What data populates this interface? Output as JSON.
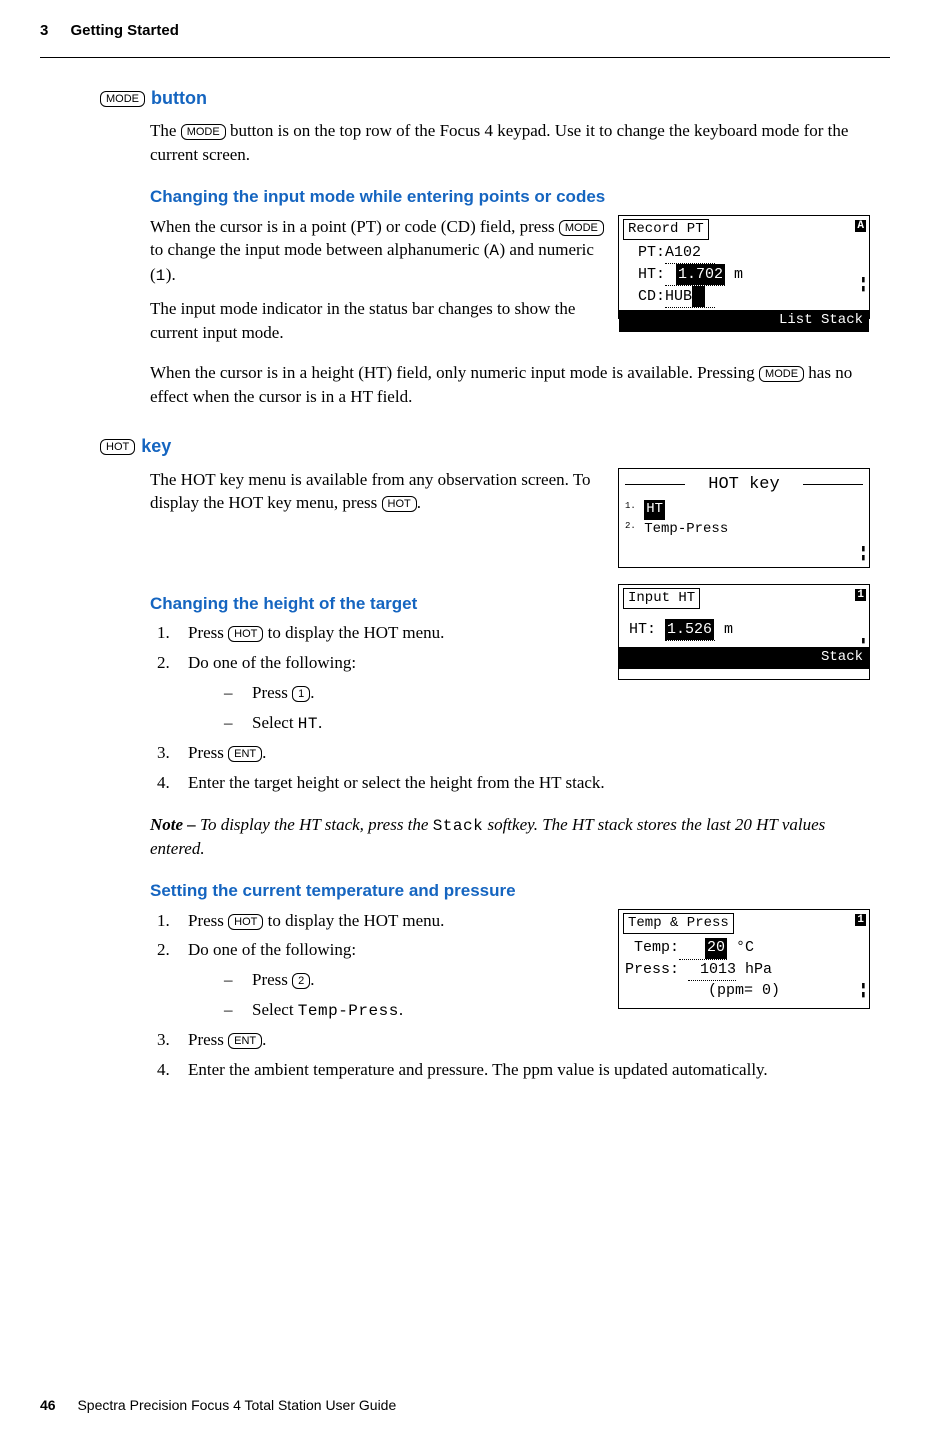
{
  "header": {
    "chapter_num": "3",
    "chapter_title": "Getting Started"
  },
  "footer": {
    "page_num": "46",
    "book_title": "Spectra Precision Focus 4 Total Station User Guide"
  },
  "keys": {
    "mode": "MODE",
    "hot": "HOT",
    "ent": "ENT",
    "one": "1",
    "two": "2"
  },
  "mono": {
    "A": "A",
    "one": "1",
    "HT": "HT",
    "TempPress": "Temp-Press",
    "Stack": "Stack"
  },
  "sec_mode": {
    "title_suffix": "button",
    "p1a": "The ",
    "p1b": " button is on the top row of the Focus 4 keypad. Use it to change the keyboard mode for the current screen."
  },
  "sec_changing_input": {
    "title": "Changing the input mode while entering points or codes",
    "p1a": "When the cursor is in a point (PT) or code (CD) field, press ",
    "p1b": " to change the input mode between alphanumeric (",
    "p1c": ") and numeric (",
    "p1d": ").",
    "p2": "The input mode indicator in the status bar changes to show the current input mode.",
    "p3a": "When the cursor is in a height (HT) field, only numeric input mode is available. Pressing ",
    "p3b": " has no effect when the cursor is in a HT field."
  },
  "sec_hot": {
    "title_suffix": "key",
    "p1a": "The HOT key menu is available from any observation screen. To display the HOT key menu, press ",
    "p1b": "."
  },
  "sec_height": {
    "title": "Changing the height of the target",
    "s1a": "Press ",
    "s1b": " to display the HOT menu.",
    "s2": "Do one of the following:",
    "s2a": "Press ",
    "s2a2": ".",
    "s2b": "Select ",
    "s2b2": ".",
    "s3a": "Press ",
    "s3b": ".",
    "s4": "Enter the target height or select the height from the HT stack.",
    "note_label": "Note – ",
    "note_a": "To display the HT stack, press the ",
    "note_b": " softkey. The HT stack stores the last 20 HT values entered."
  },
  "sec_temp": {
    "title": "Setting the current temperature and pressure",
    "s1a": "Press ",
    "s1b": " to display the HOT menu.",
    "s2": "Do one of the following:",
    "s2a": "Press ",
    "s2a2": ".",
    "s2b": "Select ",
    "s2b2": ".",
    "s3a": "Press ",
    "s3b": ".",
    "s4": "Enter the ambient temperature and pressure. The ppm value is updated automatically."
  },
  "lcd_record": {
    "title": "Record PT",
    "badge": "A",
    "pt_label": "PT:",
    "pt_val": "A102",
    "ht_label": "HT:",
    "ht_val": "1.702",
    "ht_unit": "m",
    "cd_label": "CD:",
    "cd_val": "HUB",
    "footer": "List  Stack"
  },
  "lcd_hot": {
    "title": "HOT key",
    "item1": "HT",
    "item2": "Temp-Press"
  },
  "lcd_inputht": {
    "title": "Input HT",
    "badge": "1",
    "label": "HT:",
    "val": "1.526",
    "unit": "m",
    "footer": "Stack"
  },
  "lcd_temp": {
    "title": "Temp & Press",
    "badge": "1",
    "temp_label": "Temp:",
    "temp_val": "20",
    "temp_unit": "°C",
    "press_label": "Press:",
    "press_val": "1013",
    "press_unit": "hPa",
    "ppm": "(ppm=   0)"
  }
}
